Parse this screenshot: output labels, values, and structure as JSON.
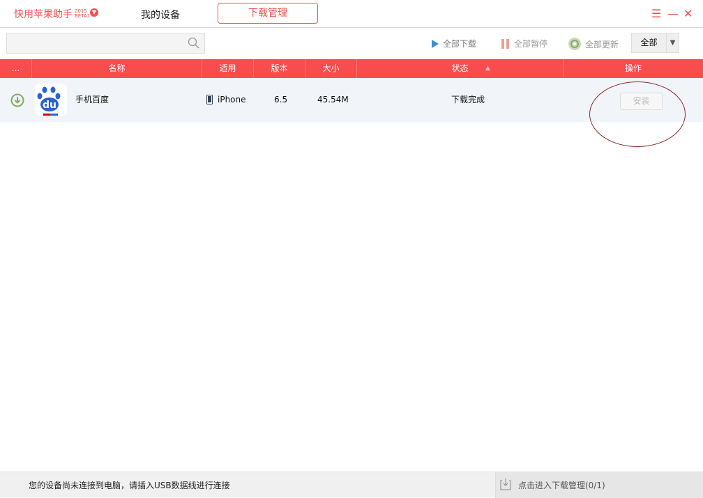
{
  "header": {
    "brand": "快用苹果助手",
    "brand_year": "2015",
    "brand_tag": "BETA1",
    "tabs": [
      "我的设备",
      "下载管理"
    ],
    "active_tab": "下载管理",
    "accent": "#f25050"
  },
  "toolbar": {
    "search_placeholder": "",
    "download_all": "全部下载",
    "pause_all": "全部暂停",
    "update_all": "全部更新",
    "filter_value": "全部"
  },
  "table": {
    "columns": [
      "...",
      "名称",
      "适用",
      "版本",
      "大小",
      "状态",
      "操作"
    ],
    "sort_column": "状态",
    "sort_dir": "asc",
    "rows": [
      {
        "name": "手机百度",
        "device": "iPhone",
        "version": "6.5",
        "size": "45.54M",
        "status": "下载完成",
        "action": "安装",
        "action_enabled": false,
        "icon": "baidu-app-icon"
      }
    ]
  },
  "footer": {
    "message": "您的设备尚未连接到电脑，请插入USB数据线进行连接",
    "link": "点击进入下载管理(0/1)"
  }
}
